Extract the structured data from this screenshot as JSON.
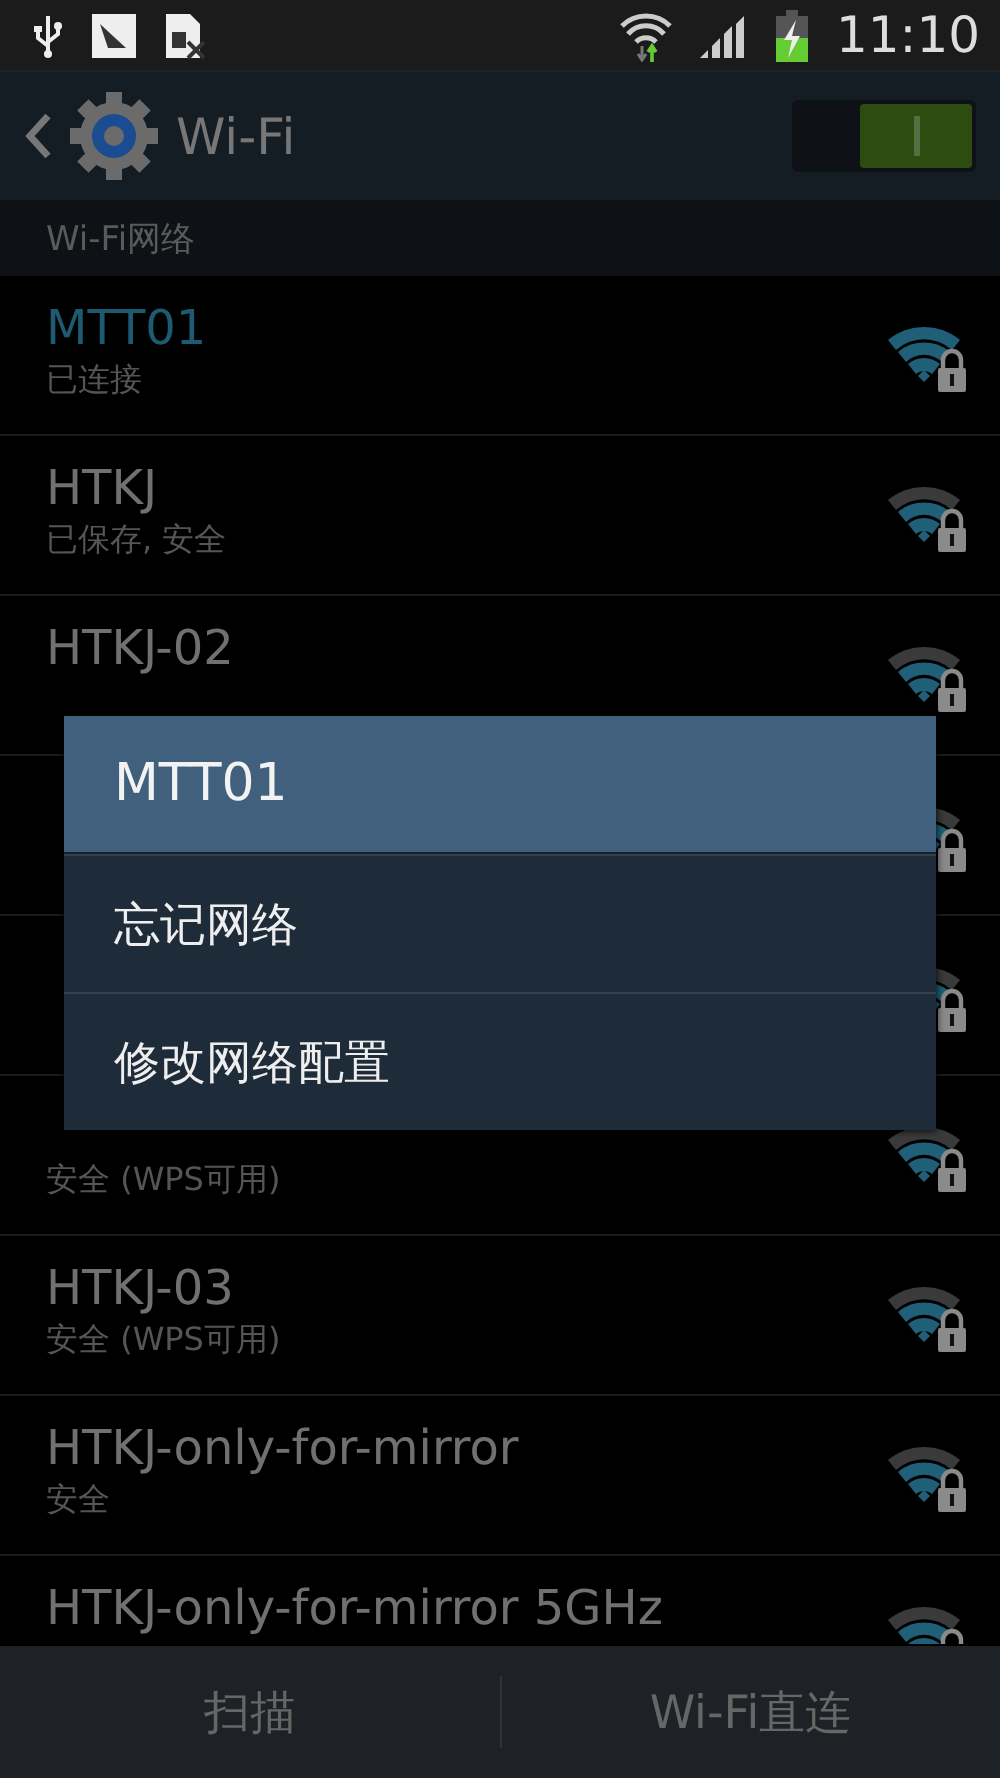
{
  "status_bar": {
    "time": "11:10"
  },
  "action_bar": {
    "title": "Wi-Fi",
    "wifi_on": true
  },
  "section_header": "Wi-Fi网络",
  "networks": [
    {
      "name": "MTT01",
      "status": "已连接",
      "connected": true
    },
    {
      "name": "HTKJ",
      "status": "已保存, 安全",
      "connected": false
    },
    {
      "name": "HTKJ-02",
      "connected": false
    },
    {
      "connected": false
    },
    {
      "connected": false
    },
    {
      "status": "安全 (WPS可用)",
      "connected": false
    },
    {
      "name": "HTKJ-03",
      "status": "安全 (WPS可用)",
      "connected": false
    },
    {
      "name": "HTKJ-only-for-mirror",
      "status": "安全",
      "connected": false
    },
    {
      "name": "HTKJ-only-for-mirror 5GHz",
      "connected": false
    }
  ],
  "dialog": {
    "title": "MTT01",
    "items": [
      "忘记网络",
      "修改网络配置"
    ]
  },
  "bottom_bar": [
    "扫描",
    "Wi-Fi直连"
  ]
}
